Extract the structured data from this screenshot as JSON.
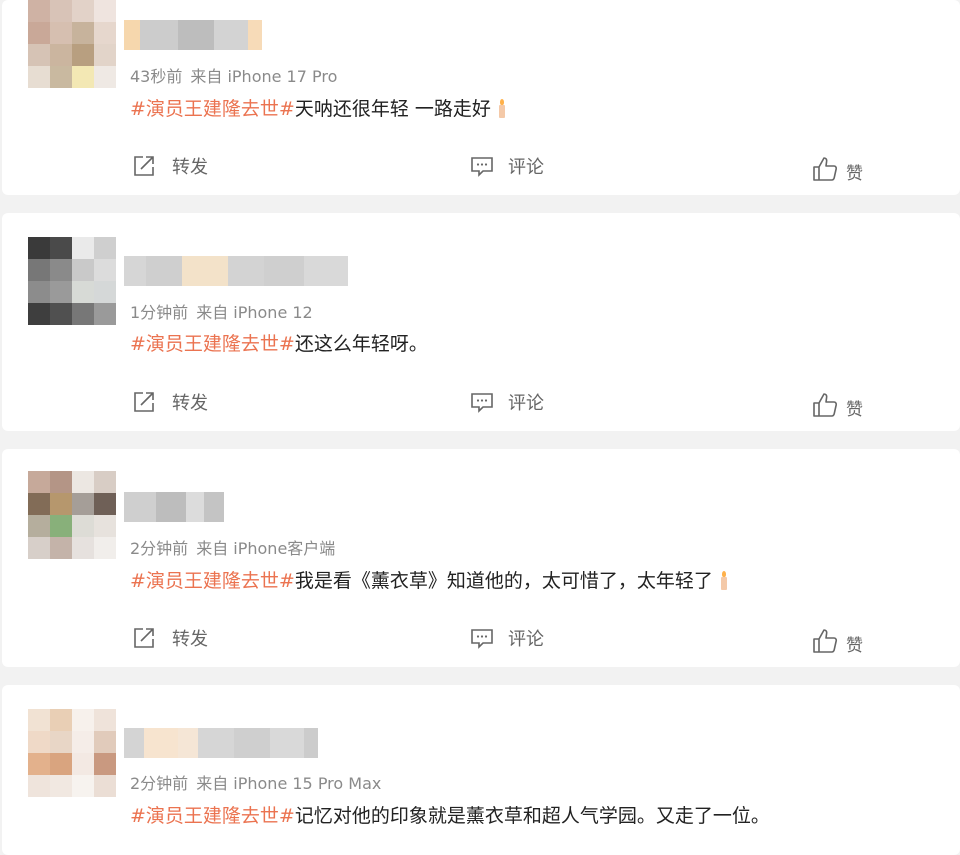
{
  "posts": [
    {
      "meta_time": "43秒前",
      "meta_source": "来自 iPhone 17 Pro",
      "hashtag": "#演员王建隆去世#",
      "text": "天呐还很年轻 一路走好",
      "has_candle": true,
      "actions": {
        "repost": "转发",
        "comment": "评论",
        "like": "赞"
      }
    },
    {
      "meta_time": "1分钟前",
      "meta_source": "来自 iPhone 12",
      "hashtag": "#演员王建隆去世#",
      "text": "还这么年轻呀。",
      "has_candle": false,
      "actions": {
        "repost": "转发",
        "comment": "评论",
        "like": "赞"
      }
    },
    {
      "meta_time": "2分钟前",
      "meta_source": "来自 iPhone客户端",
      "hashtag": "#演员王建隆去世#",
      "text": "我是看《薰衣草》知道他的，太可惜了，太年轻了",
      "has_candle": true,
      "actions": {
        "repost": "转发",
        "comment": "评论",
        "like": "赞"
      }
    },
    {
      "meta_time": "2分钟前",
      "meta_source": "来自 iPhone 15 Pro Max",
      "hashtag": "#演员王建隆去世#",
      "text": "记忆对他的印象就是薰衣草和超人气学园。又走了一位。",
      "has_candle": false,
      "actions": null
    }
  ],
  "icons": {
    "repost": "repost-icon",
    "comment": "comment-icon",
    "like": "thumbs-up-icon",
    "candle": "candle-emoji-icon"
  },
  "colors": {
    "hashtag": "#eb7350",
    "meta": "#8a8a8a",
    "background": "#f2f2f2"
  }
}
